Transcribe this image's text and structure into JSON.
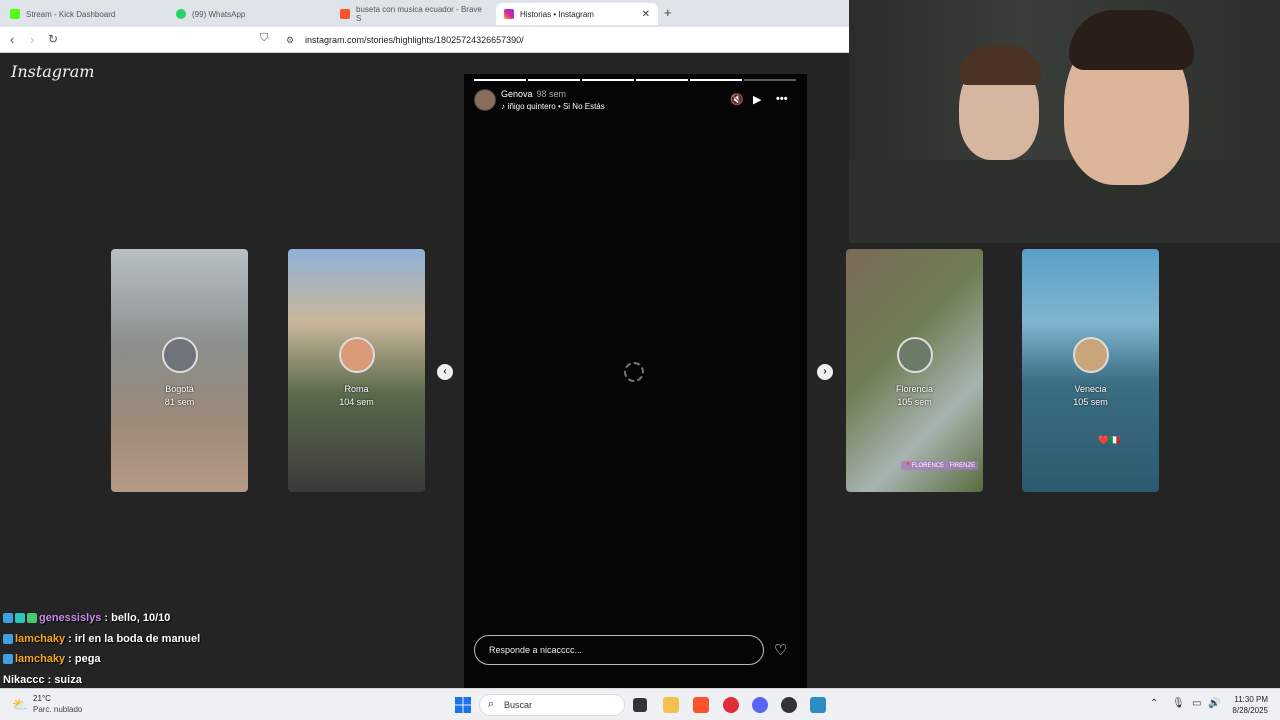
{
  "browser": {
    "tabs": [
      {
        "title": "Stream - Kick Dashboard",
        "color": "#53fc18"
      },
      {
        "title": "(99) WhatsApp",
        "color": "#25d366"
      },
      {
        "title": "buseta con musica ecuador - Brave S",
        "color": "#fb542b"
      },
      {
        "title": "Historias • Instagram",
        "color": "#d6249f"
      }
    ],
    "new_tab": "+",
    "url": "instagram.com/stories/highlights/18025724326657390/"
  },
  "instagram": {
    "logo": "Instagram",
    "story": {
      "username": "Genova",
      "time": "98 sem",
      "music": "íñigo quintero • Si No Estás",
      "progress_total": 6,
      "progress_done": 5,
      "reply_placeholder": "Responde a nicacccc..."
    },
    "highlights": [
      {
        "title": "Bogotá",
        "time": "81 sem"
      },
      {
        "title": "Roma",
        "time": "104 sem"
      },
      {
        "title": "Florencia",
        "time": "105 sem"
      },
      {
        "title": "Venecia",
        "time": "105 sem"
      }
    ],
    "florence_tag": "📍FLORENCE · FIRENZE",
    "venice_tag": "❤️🇮🇹"
  },
  "chat": [
    {
      "user": "genessislys",
      "user_color": "#c98bf0",
      "text": ": bello, 10/10",
      "badges": 3
    },
    {
      "user": "lamchaky",
      "user_color": "#f5a623",
      "text": ": irl en la boda de manuel",
      "badges": 1
    },
    {
      "user": "lamchaky",
      "user_color": "#f5a623",
      "text": ": pega",
      "badges": 1
    },
    {
      "user": "Nikaccc",
      "user_color": "#ffffff",
      "text": ": suiza",
      "badges": 0
    }
  ],
  "taskbar": {
    "temperature": "21°C",
    "weather": "Parc. nublado",
    "search": "Buscar",
    "time": "11:30 PM",
    "date": "8/28/2025"
  }
}
